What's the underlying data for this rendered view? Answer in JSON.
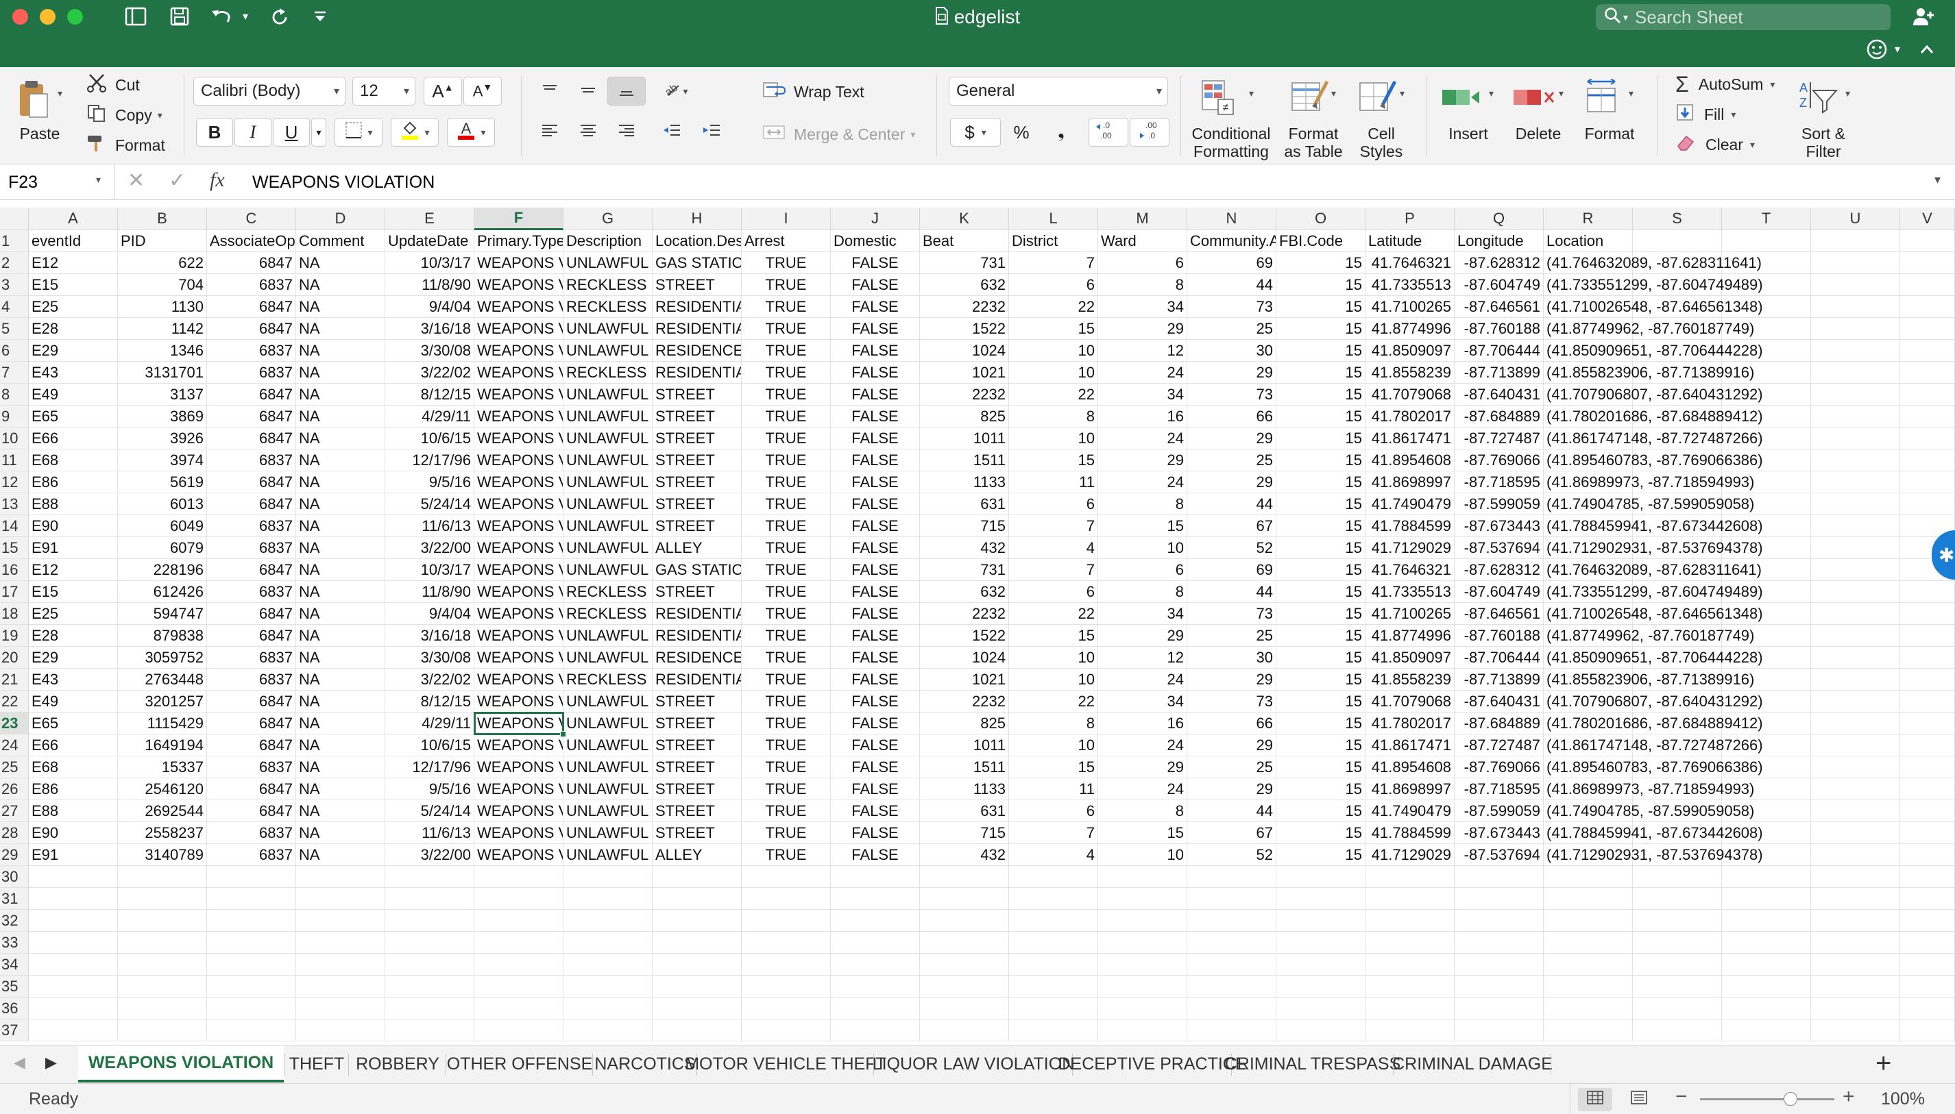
{
  "window": {
    "title": "edgelist",
    "search_placeholder": "Search Sheet"
  },
  "ribbon": {
    "paste": "Paste",
    "cut": "Cut",
    "copy": "Copy",
    "format_painter": "Format",
    "font_name": "Calibri (Body)",
    "font_size": "12",
    "bold": "B",
    "italic": "I",
    "underline": "U",
    "wrap_text": "Wrap Text",
    "merge_center": "Merge & Center",
    "number_format": "General",
    "currency": "$",
    "percent": "%",
    "comma": "❟",
    "conditional_formatting_1": "Conditional",
    "conditional_formatting_2": "Formatting",
    "format_as_table_1": "Format",
    "format_as_table_2": "as Table",
    "cell_styles_1": "Cell",
    "cell_styles_2": "Styles",
    "insert": "Insert",
    "delete": "Delete",
    "format": "Format",
    "autosum": "AutoSum",
    "fill": "Fill",
    "clear": "Clear",
    "sort_filter_1": "Sort &",
    "sort_filter_2": "Filter"
  },
  "formula_bar": {
    "name_box": "F23",
    "fx": "fx",
    "content": "WEAPONS VIOLATION"
  },
  "grid": {
    "columns": [
      "A",
      "B",
      "C",
      "D",
      "E",
      "F",
      "G",
      "H",
      "I",
      "J",
      "K",
      "L",
      "M",
      "N",
      "O",
      "P",
      "Q",
      "R",
      "S",
      "T",
      "U",
      "V"
    ],
    "selected_column": "F",
    "selected_row": 23,
    "headers": [
      "eventId",
      "PID",
      "AssociateOp",
      "Comment",
      "UpdateDate",
      "Primary.Type",
      "Description",
      "Location.Des",
      "Arrest",
      "Domestic",
      "Beat",
      "District",
      "Ward",
      "Community.A",
      "FBI.Code",
      "Latitude",
      "Longitude",
      "Location"
    ],
    "rows": [
      [
        "E12",
        "622",
        "6847",
        "NA",
        "10/3/17",
        "WEAPONS VI",
        "UNLAWFUL P",
        "GAS STATION",
        "TRUE",
        "FALSE",
        "731",
        "7",
        "6",
        "69",
        "15",
        "41.7646321",
        "-87.628312",
        "(41.764632089, -87.628311641)"
      ],
      [
        "E15",
        "704",
        "6837",
        "NA",
        "11/8/90",
        "WEAPONS VI",
        "RECKLESS FIR",
        "STREET",
        "TRUE",
        "FALSE",
        "632",
        "6",
        "8",
        "44",
        "15",
        "41.7335513",
        "-87.604749",
        "(41.733551299, -87.604749489)"
      ],
      [
        "E25",
        "1130",
        "6847",
        "NA",
        "9/4/04",
        "WEAPONS VI",
        "RECKLESS FIR",
        "RESIDENTIAL",
        "TRUE",
        "FALSE",
        "2232",
        "22",
        "34",
        "73",
        "15",
        "41.7100265",
        "-87.646561",
        "(41.710026548, -87.646561348)"
      ],
      [
        "E28",
        "1142",
        "6847",
        "NA",
        "3/16/18",
        "WEAPONS VI",
        "UNLAWFUL P",
        "RESIDENTIAL",
        "TRUE",
        "FALSE",
        "1522",
        "15",
        "29",
        "25",
        "15",
        "41.8774996",
        "-87.760188",
        "(41.87749962, -87.760187749)"
      ],
      [
        "E29",
        "1346",
        "6837",
        "NA",
        "3/30/08",
        "WEAPONS VI",
        "UNLAWFUL P",
        "RESIDENCE",
        "TRUE",
        "FALSE",
        "1024",
        "10",
        "12",
        "30",
        "15",
        "41.8509097",
        "-87.706444",
        "(41.850909651, -87.706444228)"
      ],
      [
        "E43",
        "3131701",
        "6837",
        "NA",
        "3/22/02",
        "WEAPONS VI",
        "RECKLESS FIR",
        "RESIDENTIAL",
        "TRUE",
        "FALSE",
        "1021",
        "10",
        "24",
        "29",
        "15",
        "41.8558239",
        "-87.713899",
        "(41.855823906, -87.71389916)"
      ],
      [
        "E49",
        "3137",
        "6847",
        "NA",
        "8/12/15",
        "WEAPONS VI",
        "UNLAWFUL P",
        "STREET",
        "TRUE",
        "FALSE",
        "2232",
        "22",
        "34",
        "73",
        "15",
        "41.7079068",
        "-87.640431",
        "(41.707906807, -87.640431292)"
      ],
      [
        "E65",
        "3869",
        "6847",
        "NA",
        "4/29/11",
        "WEAPONS VI",
        "UNLAWFUL P",
        "STREET",
        "TRUE",
        "FALSE",
        "825",
        "8",
        "16",
        "66",
        "15",
        "41.7802017",
        "-87.684889",
        "(41.780201686, -87.684889412)"
      ],
      [
        "E66",
        "3926",
        "6847",
        "NA",
        "10/6/15",
        "WEAPONS VI",
        "UNLAWFUL P",
        "STREET",
        "TRUE",
        "FALSE",
        "1011",
        "10",
        "24",
        "29",
        "15",
        "41.8617471",
        "-87.727487",
        "(41.861747148, -87.727487266)"
      ],
      [
        "E68",
        "3974",
        "6837",
        "NA",
        "12/17/96",
        "WEAPONS VI",
        "UNLAWFUL P",
        "STREET",
        "TRUE",
        "FALSE",
        "1511",
        "15",
        "29",
        "25",
        "15",
        "41.8954608",
        "-87.769066",
        "(41.895460783, -87.769066386)"
      ],
      [
        "E86",
        "5619",
        "6847",
        "NA",
        "9/5/16",
        "WEAPONS VI",
        "UNLAWFUL P",
        "STREET",
        "TRUE",
        "FALSE",
        "1133",
        "11",
        "24",
        "29",
        "15",
        "41.8698997",
        "-87.718595",
        "(41.86989973, -87.718594993)"
      ],
      [
        "E88",
        "6013",
        "6847",
        "NA",
        "5/24/14",
        "WEAPONS VI",
        "UNLAWFUL P",
        "STREET",
        "TRUE",
        "FALSE",
        "631",
        "6",
        "8",
        "44",
        "15",
        "41.7490479",
        "-87.599059",
        "(41.74904785, -87.599059058)"
      ],
      [
        "E90",
        "6049",
        "6837",
        "NA",
        "11/6/13",
        "WEAPONS VI",
        "UNLAWFUL P",
        "STREET",
        "TRUE",
        "FALSE",
        "715",
        "7",
        "15",
        "67",
        "15",
        "41.7884599",
        "-87.673443",
        "(41.788459941, -87.673442608)"
      ],
      [
        "E91",
        "6079",
        "6837",
        "NA",
        "3/22/00",
        "WEAPONS VI",
        "UNLAWFUL U",
        "ALLEY",
        "TRUE",
        "FALSE",
        "432",
        "4",
        "10",
        "52",
        "15",
        "41.7129029",
        "-87.537694",
        "(41.712902931, -87.537694378)"
      ],
      [
        "E12",
        "228196",
        "6847",
        "NA",
        "10/3/17",
        "WEAPONS VI",
        "UNLAWFUL P",
        "GAS STATION",
        "TRUE",
        "FALSE",
        "731",
        "7",
        "6",
        "69",
        "15",
        "41.7646321",
        "-87.628312",
        "(41.764632089, -87.628311641)"
      ],
      [
        "E15",
        "612426",
        "6837",
        "NA",
        "11/8/90",
        "WEAPONS VI",
        "RECKLESS FIR",
        "STREET",
        "TRUE",
        "FALSE",
        "632",
        "6",
        "8",
        "44",
        "15",
        "41.7335513",
        "-87.604749",
        "(41.733551299, -87.604749489)"
      ],
      [
        "E25",
        "594747",
        "6847",
        "NA",
        "9/4/04",
        "WEAPONS VI",
        "RECKLESS FIR",
        "RESIDENTIAL",
        "TRUE",
        "FALSE",
        "2232",
        "22",
        "34",
        "73",
        "15",
        "41.7100265",
        "-87.646561",
        "(41.710026548, -87.646561348)"
      ],
      [
        "E28",
        "879838",
        "6847",
        "NA",
        "3/16/18",
        "WEAPONS VI",
        "UNLAWFUL P",
        "RESIDENTIAL",
        "TRUE",
        "FALSE",
        "1522",
        "15",
        "29",
        "25",
        "15",
        "41.8774996",
        "-87.760188",
        "(41.87749962, -87.760187749)"
      ],
      [
        "E29",
        "3059752",
        "6837",
        "NA",
        "3/30/08",
        "WEAPONS VI",
        "UNLAWFUL P",
        "RESIDENCE",
        "TRUE",
        "FALSE",
        "1024",
        "10",
        "12",
        "30",
        "15",
        "41.8509097",
        "-87.706444",
        "(41.850909651, -87.706444228)"
      ],
      [
        "E43",
        "2763448",
        "6837",
        "NA",
        "3/22/02",
        "WEAPONS VI",
        "RECKLESS FIR",
        "RESIDENTIAL",
        "TRUE",
        "FALSE",
        "1021",
        "10",
        "24",
        "29",
        "15",
        "41.8558239",
        "-87.713899",
        "(41.855823906, -87.71389916)"
      ],
      [
        "E49",
        "3201257",
        "6847",
        "NA",
        "8/12/15",
        "WEAPONS VI",
        "UNLAWFUL P",
        "STREET",
        "TRUE",
        "FALSE",
        "2232",
        "22",
        "34",
        "73",
        "15",
        "41.7079068",
        "-87.640431",
        "(41.707906807, -87.640431292)"
      ],
      [
        "E65",
        "1115429",
        "6847",
        "NA",
        "4/29/11",
        "WEAPONS V",
        "UNLAWFUL P",
        "STREET",
        "TRUE",
        "FALSE",
        "825",
        "8",
        "16",
        "66",
        "15",
        "41.7802017",
        "-87.684889",
        "(41.780201686, -87.684889412)"
      ],
      [
        "E66",
        "1649194",
        "6847",
        "NA",
        "10/6/15",
        "WEAPONS VI",
        "UNLAWFUL P",
        "STREET",
        "TRUE",
        "FALSE",
        "1011",
        "10",
        "24",
        "29",
        "15",
        "41.8617471",
        "-87.727487",
        "(41.861747148, -87.727487266)"
      ],
      [
        "E68",
        "15337",
        "6837",
        "NA",
        "12/17/96",
        "WEAPONS VI",
        "UNLAWFUL P",
        "STREET",
        "TRUE",
        "FALSE",
        "1511",
        "15",
        "29",
        "25",
        "15",
        "41.8954608",
        "-87.769066",
        "(41.895460783, -87.769066386)"
      ],
      [
        "E86",
        "2546120",
        "6847",
        "NA",
        "9/5/16",
        "WEAPONS VI",
        "UNLAWFUL P",
        "STREET",
        "TRUE",
        "FALSE",
        "1133",
        "11",
        "24",
        "29",
        "15",
        "41.8698997",
        "-87.718595",
        "(41.86989973, -87.718594993)"
      ],
      [
        "E88",
        "2692544",
        "6847",
        "NA",
        "5/24/14",
        "WEAPONS VI",
        "UNLAWFUL P",
        "STREET",
        "TRUE",
        "FALSE",
        "631",
        "6",
        "8",
        "44",
        "15",
        "41.7490479",
        "-87.599059",
        "(41.74904785, -87.599059058)"
      ],
      [
        "E90",
        "2558237",
        "6837",
        "NA",
        "11/6/13",
        "WEAPONS VI",
        "UNLAWFUL P",
        "STREET",
        "TRUE",
        "FALSE",
        "715",
        "7",
        "15",
        "67",
        "15",
        "41.7884599",
        "-87.673443",
        "(41.788459941, -87.673442608)"
      ],
      [
        "E91",
        "3140789",
        "6837",
        "NA",
        "3/22/00",
        "WEAPONS VI",
        "UNLAWFUL U",
        "ALLEY",
        "TRUE",
        "FALSE",
        "432",
        "4",
        "10",
        "52",
        "15",
        "41.7129029",
        "-87.537694",
        "(41.712902931, -87.537694378)"
      ]
    ],
    "empty_row_numbers": [
      30,
      31,
      32,
      33,
      34,
      35,
      36,
      37
    ]
  },
  "sheet_tabs": [
    {
      "label": "WEAPONS VIOLATION",
      "active": true
    },
    {
      "label": "THEFT",
      "active": false
    },
    {
      "label": "ROBBERY",
      "active": false
    },
    {
      "label": "OTHER OFFENSE",
      "active": false
    },
    {
      "label": "NARCOTICS",
      "active": false
    },
    {
      "label": "MOTOR VEHICLE THEFT",
      "active": false
    },
    {
      "label": "LIQUOR LAW VIOLATION",
      "active": false
    },
    {
      "label": "DECEPTIVE PRACTICE",
      "active": false
    },
    {
      "label": "CRIMINAL TRESPASS",
      "active": false
    },
    {
      "label": "CRIMINAL DAMAGE",
      "active": false
    }
  ],
  "status": {
    "text": "Ready",
    "zoom": "100%",
    "zoom_level": 1.0
  },
  "colors": {
    "accent": "#217346",
    "ribbon_bg": "#f3f3f3",
    "header_bg": "#f2f2f2"
  }
}
